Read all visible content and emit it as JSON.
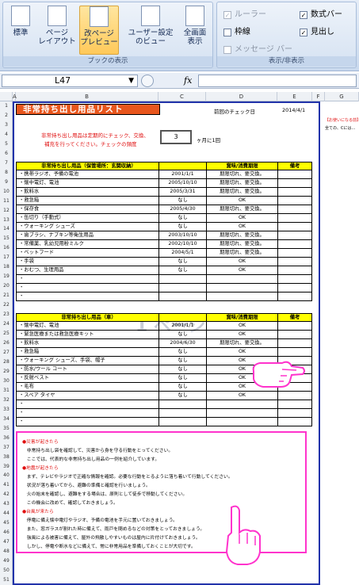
{
  "ribbon": {
    "views": [
      {
        "label_l1": "標準",
        "label_l2": ""
      },
      {
        "label_l1": "ページ",
        "label_l2": "レイアウト"
      },
      {
        "label_l1": "改ページ",
        "label_l2": "プレビュー"
      },
      {
        "label_l1": "ユーザー設定",
        "label_l2": "のビュー"
      },
      {
        "label_l1": "全画面",
        "label_l2": "表示"
      }
    ],
    "views_group_label": "ブックの表示",
    "show_group_label": "表示/非表示",
    "checks": [
      {
        "label": "ルーラー",
        "checked": "✓",
        "disabled": true
      },
      {
        "label": "枠線",
        "checked": "",
        "disabled": false
      },
      {
        "label": "メッセージ バー",
        "checked": "",
        "disabled": true
      },
      {
        "label": "数式バー",
        "checked": "✓",
        "disabled": false
      },
      {
        "label": "見出し",
        "checked": "✓",
        "disabled": false
      }
    ]
  },
  "formula_bar": {
    "name_box": "L47",
    "fx": "fx",
    "value": ""
  },
  "sheet": {
    "columns": [
      "A",
      "B",
      "C",
      "D",
      "E",
      "F",
      "G"
    ],
    "rows": [
      "1",
      "2",
      "3",
      "4",
      "5",
      "6",
      "7",
      "8",
      "9",
      "10",
      "11",
      "12",
      "13",
      "14",
      "15",
      "16",
      "17",
      "18",
      "19",
      "20",
      "21",
      "22",
      "23",
      "24",
      "25",
      "26",
      "27",
      "28",
      "29",
      "30",
      "31",
      "32",
      "33",
      "34",
      "35",
      "36",
      "37",
      "38",
      "39",
      "40",
      "41",
      "42",
      "43",
      "44",
      "45",
      "46",
      "47",
      "48",
      "49",
      "50",
      "51"
    ],
    "title": "非常持ち出し用品リスト",
    "check_label": "前回のチェック日",
    "check_date": "2014/4/1",
    "instruction_1": "非常持ち出し用品は定期的にチェック、交換、",
    "instruction_2": "補充を行ってください。チェックの頻度",
    "frequency": "3",
    "frequency_unit": "ヶ月に1回",
    "page_watermark": "1 ページ",
    "side_note_title": "【お使いになる前】",
    "side_note_text": "全ての、Cには…",
    "table1": {
      "headers": [
        "非常持ち出し用品（保管場所：玄関収納）",
        "",
        "賞味/消費期限",
        "備考"
      ],
      "rows": [
        [
          "・携帯ラジオ、予備の電池",
          "2001/1/1",
          "期限切れ、要交換。",
          ""
        ],
        [
          "・懐中電灯、電池",
          "2005/10/10",
          "期限切れ、要交換。",
          ""
        ],
        [
          "・飲料水",
          "2005/3/31",
          "期限切れ、要交換。",
          ""
        ],
        [
          "・救急箱",
          "なし",
          "OK",
          ""
        ],
        [
          "・保存食",
          "2005/4/30",
          "期限切れ、要交換。",
          ""
        ],
        [
          "・缶切り（手動式）",
          "なし",
          "OK",
          ""
        ],
        [
          "・ウォーキング シューズ",
          "なし",
          "OK",
          ""
        ],
        [
          "・歯ブラシ、ナプキン等衛生用品",
          "2003/10/10",
          "期限切れ、要交換。",
          ""
        ],
        [
          "・常備薬、乳幼児用粉ミルク",
          "2002/10/10",
          "期限切れ、要交換。",
          ""
        ],
        [
          "・ベットフード",
          "2004/5/1",
          "期限切れ、要交換。",
          ""
        ],
        [
          "・手袋",
          "なし",
          "OK",
          ""
        ],
        [
          "・おむつ、生理用品",
          "なし",
          "OK",
          ""
        ],
        [
          "・",
          "",
          "",
          ""
        ],
        [
          "・",
          "",
          "",
          ""
        ],
        [
          "・",
          "",
          "",
          ""
        ]
      ]
    },
    "table2": {
      "headers": [
        "非常持ち出し用品（車）",
        "",
        "賞味/消費期限",
        "備考"
      ],
      "rows": [
        [
          "・懐中電灯、電池",
          "2001/1/1",
          "OK",
          ""
        ],
        [
          "・緊急医療または救急医療キット",
          "なし",
          "OK",
          ""
        ],
        [
          "・飲料水",
          "2004/6/30",
          "期限切れ、要交換。",
          ""
        ],
        [
          "・救急箱",
          "なし",
          "OK",
          ""
        ],
        [
          "・ウォーキング シューズ、手袋、帽子",
          "なし",
          "OK",
          ""
        ],
        [
          "・防水/ウール コート",
          "なし",
          "OK",
          ""
        ],
        [
          "・反射ベスト",
          "なし",
          "OK",
          ""
        ],
        [
          "・毛布",
          "なし",
          "OK",
          ""
        ],
        [
          "・スペア タイヤ",
          "なし",
          "OK",
          ""
        ],
        [
          "・",
          "",
          "",
          ""
        ],
        [
          "・",
          "",
          "",
          ""
        ],
        [
          "・",
          "",
          "",
          ""
        ]
      ]
    },
    "notes": [
      "●災害が起きたら",
      "　非常持ち出し袋を確認して、災害から身を守る行動をとってください。",
      "　ここでは、代表的な非常持ち出し用品の一例を紹介しています。",
      "●地震が起きたら",
      "　まず、テレビやラジオで正確な情報を確認。必要な行動をとるように落ち着いて行動してください。",
      "　状況が落ち着いてから、避難の準備と確認を行いましょう。",
      "　火の始末を確認し、避難をする場合は、原則として徒歩で移動してください。",
      "　この機会に改めて、確認しておきましょう。",
      "●台風が来たら",
      "　停電に備え懐中電灯やラジオ、予備の電池を手元に置いておきましょう。",
      "　また、窓ガラスが割れた時に備えて、雨戸を閉めるなどの対策をとっておきましょう。",
      "　強風による被害に備えて、屋外の飛散しやすいものは屋内に片付けておきましょう。",
      "　しかし、停電や断水などに備えて、常に非常用品を準備しておくことが大切です。"
    ]
  }
}
